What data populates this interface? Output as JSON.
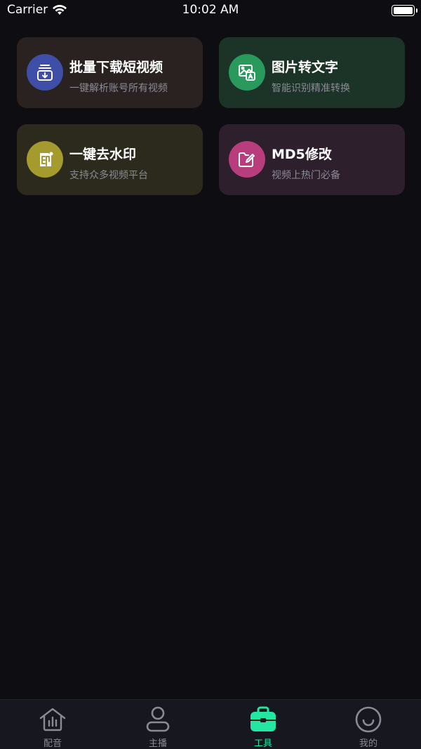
{
  "status_bar": {
    "carrier": "Carrier",
    "time": "10:02 AM"
  },
  "cards": [
    {
      "title": "批量下载短视频",
      "subtitle": "一键解析账号所有视频",
      "icon": "download-icon",
      "icon_color": "#3f4fa8",
      "card_color": "#2a2220"
    },
    {
      "title": "图片转文字",
      "subtitle": "智能识别精准转换",
      "icon": "image-text-icon",
      "icon_color": "#2a9a5c",
      "card_color": "#1c3327"
    },
    {
      "title": "一键去水印",
      "subtitle": "支持众多视频平台",
      "icon": "watermark-icon",
      "icon_color": "#a59a2e",
      "card_color": "#2b2a1c"
    },
    {
      "title": "MD5修改",
      "subtitle": "视频上热门必备",
      "icon": "folder-edit-icon",
      "icon_color": "#b83d7c",
      "card_color": "#2e1f2c"
    }
  ],
  "tabbar": {
    "active_index": 2,
    "active_color": "#23e6a0",
    "items": [
      {
        "label": "配音",
        "icon": "home-chart-icon"
      },
      {
        "label": "主播",
        "icon": "person-icon"
      },
      {
        "label": "工具",
        "icon": "toolbox-icon"
      },
      {
        "label": "我的",
        "icon": "smile-icon"
      }
    ]
  }
}
